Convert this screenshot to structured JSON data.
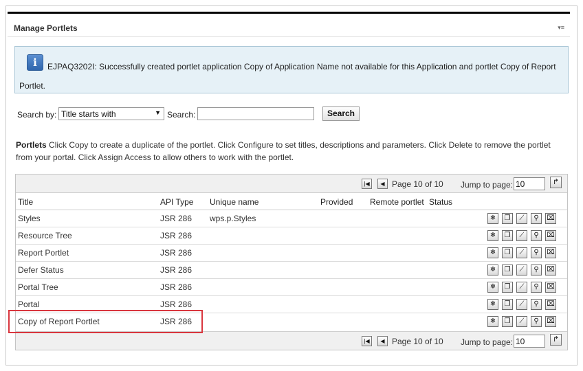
{
  "portlet": {
    "title": "Manage Portlets"
  },
  "message": {
    "text": "EJPAQ3202I: Successfully created portlet application Copy of Application Name not available for this Application and portlet Copy of Report Portlet."
  },
  "search": {
    "by_label": "Search by:",
    "selected_option": "Title starts with",
    "search_label": "Search:",
    "query": "",
    "button_label": "Search"
  },
  "description": {
    "heading": "Portlets",
    "text": "Click Copy to create a duplicate of the portlet. Click Configure to set titles, descriptions and parameters. Click Delete to remove the portlet from your portal. Click Assign Access to allow others to work with the portlet."
  },
  "pager": {
    "page_text": "Page 10 of 10",
    "jump_label": "Jump to page:",
    "jump_value": "10"
  },
  "table": {
    "columns": [
      "Title",
      "API Type",
      "Unique name",
      "Provided",
      "Remote portlet",
      "Status"
    ],
    "rows": [
      {
        "title": "Styles",
        "api": "JSR 286",
        "unique": "wps.p.Styles"
      },
      {
        "title": "Resource Tree",
        "api": "JSR 286",
        "unique": ""
      },
      {
        "title": "Report Portlet",
        "api": "JSR 286",
        "unique": ""
      },
      {
        "title": "Defer Status",
        "api": "JSR 286",
        "unique": ""
      },
      {
        "title": "Portal Tree",
        "api": "JSR 286",
        "unique": ""
      },
      {
        "title": "Portal",
        "api": "JSR 286",
        "unique": ""
      },
      {
        "title": "Copy of Report Portlet",
        "api": "JSR 286",
        "unique": ""
      }
    ],
    "highlighted_row": "Copy of Report Portlet"
  },
  "icons": {
    "menu": "menu-icon",
    "info": "info-icon",
    "first_page": "first-page-icon",
    "prev_page": "previous-page-icon",
    "go": "go-icon",
    "row_actions": [
      "assign-access-icon",
      "copy-icon",
      "configure-icon",
      "settings-icon",
      "delete-icon"
    ]
  },
  "colors": {
    "accent": "#2f66ad",
    "info_bg": "#e6f1f7",
    "highlight": "#d9363e"
  }
}
